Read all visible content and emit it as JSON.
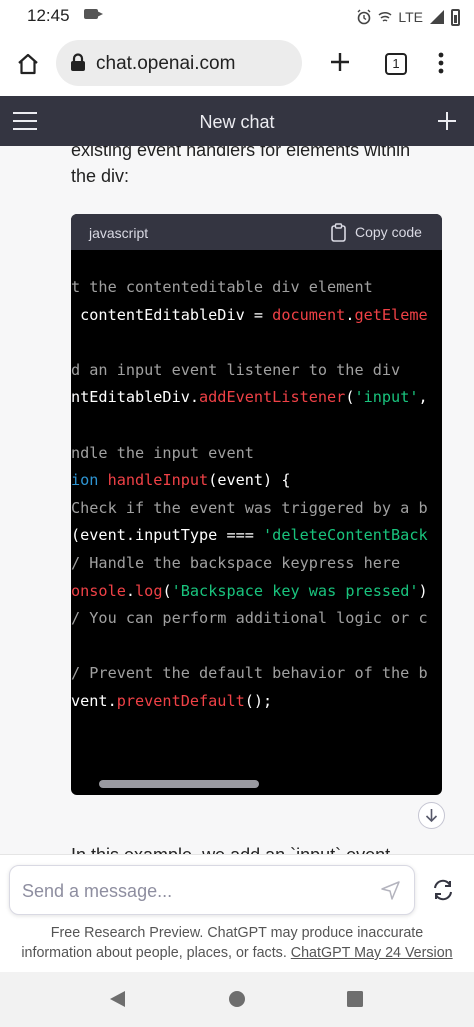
{
  "status_bar": {
    "time": "12:45",
    "network": "LTE"
  },
  "browser": {
    "url": "chat.openai.com",
    "tab_count": "1"
  },
  "chat_header": {
    "title": "New chat"
  },
  "message": {
    "text_top_partial": "existing event handlers for elements within",
    "text_top": "the div:",
    "text_bottom_partial": "In this example, we add an `input` event"
  },
  "code_block": {
    "language": "javascript",
    "copy_label": "Copy code",
    "lines": [
      [
        {
          "t": "t the contenteditable div element",
          "c": "comment"
        }
      ],
      [
        {
          "t": " contentEditableDiv = ",
          "c": "plain"
        },
        {
          "t": "document",
          "c": "red"
        },
        {
          "t": ".",
          "c": "plain"
        },
        {
          "t": "getEleme",
          "c": "red"
        }
      ],
      [
        {
          "t": "",
          "c": "plain"
        }
      ],
      [
        {
          "t": "d an input event listener to the div",
          "c": "comment"
        }
      ],
      [
        {
          "t": "ntEditableDiv.",
          "c": "plain"
        },
        {
          "t": "addEventListener",
          "c": "red"
        },
        {
          "t": "(",
          "c": "plain"
        },
        {
          "t": "'input'",
          "c": "green"
        },
        {
          "t": ",",
          "c": "plain"
        }
      ],
      [
        {
          "t": "",
          "c": "plain"
        }
      ],
      [
        {
          "t": "ndle the input event",
          "c": "comment"
        }
      ],
      [
        {
          "t": "ion",
          "c": "blue"
        },
        {
          "t": " ",
          "c": "plain"
        },
        {
          "t": "handleInput",
          "c": "red"
        },
        {
          "t": "(event) {",
          "c": "plain"
        }
      ],
      [
        {
          "t": "Check if the event was triggered by a b",
          "c": "comment"
        }
      ],
      [
        {
          "t": "(event.inputType === ",
          "c": "plain"
        },
        {
          "t": "'deleteContentBack",
          "c": "green"
        }
      ],
      [
        {
          "t": "/ Handle the backspace keypress here",
          "c": "comment"
        }
      ],
      [
        {
          "t": "onsole",
          "c": "red"
        },
        {
          "t": ".",
          "c": "plain"
        },
        {
          "t": "log",
          "c": "red"
        },
        {
          "t": "(",
          "c": "plain"
        },
        {
          "t": "'Backspace key was pressed'",
          "c": "green"
        },
        {
          "t": ")",
          "c": "plain"
        }
      ],
      [
        {
          "t": "/ You can perform additional logic or c",
          "c": "comment"
        }
      ],
      [
        {
          "t": "",
          "c": "plain"
        }
      ],
      [
        {
          "t": "/ Prevent the default behavior of the b",
          "c": "comment"
        }
      ],
      [
        {
          "t": "vent.",
          "c": "plain"
        },
        {
          "t": "preventDefault",
          "c": "red"
        },
        {
          "t": "();",
          "c": "plain"
        }
      ]
    ]
  },
  "input": {
    "placeholder": "Send a message..."
  },
  "footer": {
    "disclaimer": "Free Research Preview. ChatGPT may produce inaccurate information about people, places, or facts. ",
    "version_link": "ChatGPT May 24 Version"
  },
  "colors": {
    "header_bg": "#343541",
    "code_bg": "#000000",
    "code_comment": "#a0a0a0",
    "code_red": "#ef4146",
    "code_green": "#19c37d",
    "code_blue": "#2e95d3"
  },
  "icons": [
    "video-record-icon",
    "alarm-icon",
    "wifi-calling-icon",
    "signal-icon",
    "battery-icon",
    "home-icon",
    "lock-icon",
    "plus-icon",
    "tabs-icon",
    "menu-dots-icon",
    "hamburger-icon",
    "new-chat-plus-icon",
    "clipboard-icon",
    "arrow-down-icon",
    "send-icon",
    "refresh-icon",
    "back-triangle-icon",
    "home-circle-icon",
    "recents-square-icon"
  ]
}
